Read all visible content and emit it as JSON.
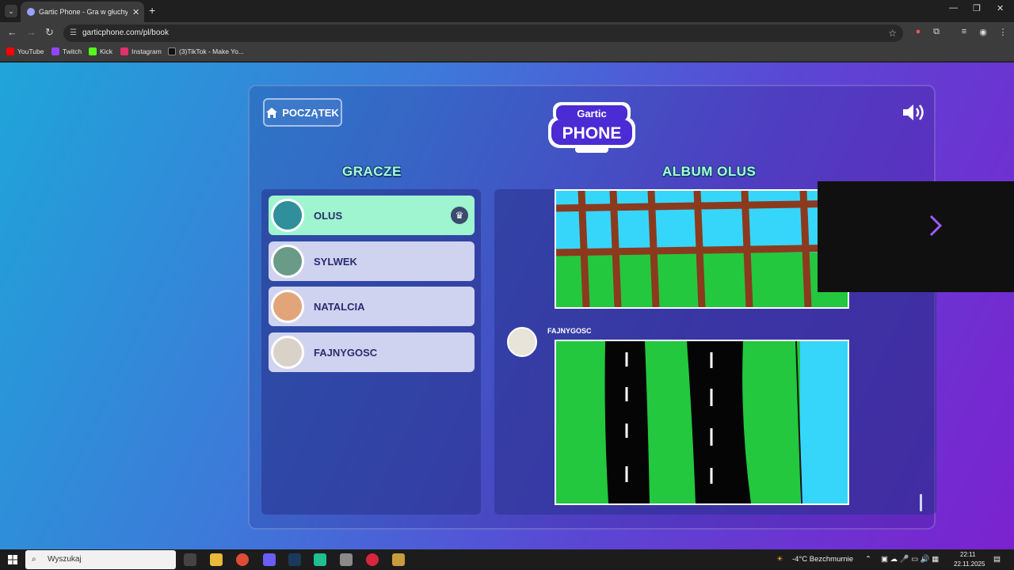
{
  "browser": {
    "tab_title": "Gartic Phone - Gra w głuchy te",
    "url": "garticphone.com/pl/book",
    "bookmarks": [
      "YouTube",
      "Twitch",
      "Kick",
      "Instagram",
      "(3)TikTok - Make Yo..."
    ]
  },
  "game": {
    "home_label": "POCZĄTEK",
    "logo_top": "Gartic",
    "logo_bottom": "PHONE",
    "players_heading": "GRACZE",
    "album_heading": "ALBUM OLUS",
    "players": [
      {
        "name": "OLUS",
        "active": true,
        "host": true
      },
      {
        "name": "SYLWEK"
      },
      {
        "name": "NATALCIA"
      },
      {
        "name": "FAJNYGOSC"
      }
    ],
    "album_author": "FAJNYGOSC"
  },
  "taskbar": {
    "search_placeholder": "Wyszukaj",
    "weather": "-4°C  Bezchmurnie",
    "time": "22:11",
    "date": "22.11.2025"
  },
  "colors": {
    "accent": "#a4ffd8",
    "sky": "#36d6fb",
    "grass": "#23c83e",
    "fence": "#8b3a1e"
  }
}
